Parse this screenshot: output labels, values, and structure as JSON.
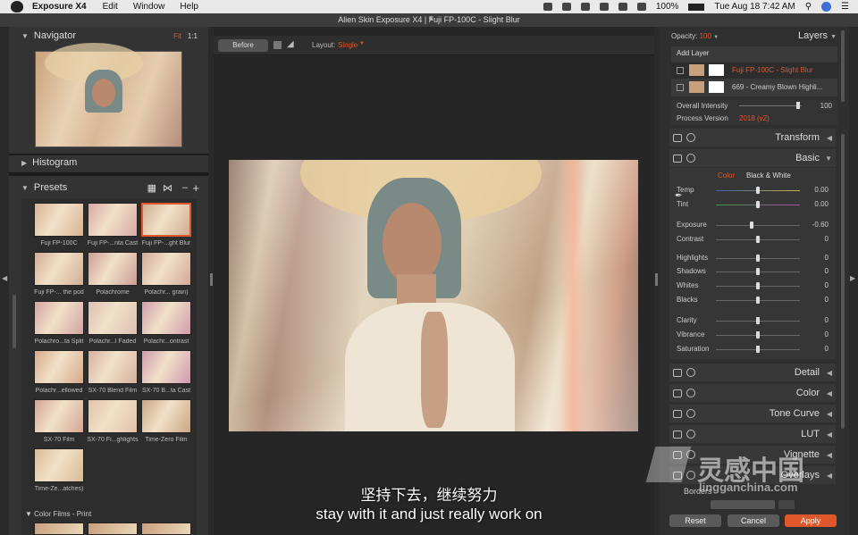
{
  "menubar": {
    "app": "Exposure X4",
    "items": [
      "Edit",
      "Window",
      "Help"
    ],
    "battery": "100%",
    "datetime": "Tue Aug 18  7:42 AM"
  },
  "window": {
    "title": "Alien Skin Exposure X4 | Fuji FP-100C - Slight Blur"
  },
  "navigator": {
    "title": "Navigator",
    "zoom_fit": "Fit",
    "zoom_1": "1:1"
  },
  "histogram": {
    "title": "Histogram"
  },
  "presets": {
    "title": "Presets",
    "items": [
      {
        "label": "Fuji FP-100C"
      },
      {
        "label": "Fuji FP-...nta Cast"
      },
      {
        "label": "Fuji FP-...ght Blur"
      },
      {
        "label": "Fuji FP-... the pod"
      },
      {
        "label": "Polachrome"
      },
      {
        "label": "Polachr... grain)"
      },
      {
        "label": "Polachro...ta Split"
      },
      {
        "label": "Polachr...l Faded"
      },
      {
        "label": "Polachr...ontrast"
      },
      {
        "label": "Polachr...ellowed"
      },
      {
        "label": "SX-70 Blend Film"
      },
      {
        "label": "SX-70 B...ta Cast"
      },
      {
        "label": "SX-70 Film"
      },
      {
        "label": "SX-70 Fi...ghlights"
      },
      {
        "label": "Time-Zero Film"
      },
      {
        "label": "Time-Ze...atches)"
      }
    ],
    "group": "Color Films - Print"
  },
  "toolbar": {
    "before_label": "Before",
    "layout_label": "Layout:",
    "layout_value": "Single"
  },
  "layers": {
    "opacity_label": "Opacity:",
    "opacity_value": "100",
    "title": "Layers",
    "add_layer": "Add Layer",
    "items": [
      {
        "name": "Fuji FP-100C - Slight Blur"
      },
      {
        "name": "669 - Creamy Blown Highli..."
      }
    ],
    "overall_intensity_label": "Overall Intensity",
    "overall_intensity_value": "100",
    "process_version_label": "Process Version",
    "process_version_value": "2018 (v2)"
  },
  "panels": {
    "transform": "Transform",
    "basic": "Basic",
    "color_tab": "Color",
    "bw_tab": "Black & White",
    "detail": "Detail",
    "color": "Color",
    "tone_curve": "Tone Curve",
    "lut": "LUT",
    "vignette": "Vignette",
    "overlays": "Overlays",
    "borders": "Borders"
  },
  "basic_sliders": [
    {
      "label": "Temp",
      "value": "0.00",
      "level": 0.5
    },
    {
      "label": "Tint",
      "value": "0.00",
      "level": 0.5
    },
    {
      "label": "Exposure",
      "value": "-0.60",
      "level": 0.43
    },
    {
      "label": "Contrast",
      "value": "0",
      "level": 0.5
    },
    {
      "label": "Highlights",
      "value": "0",
      "level": 0.5
    },
    {
      "label": "Shadows",
      "value": "0",
      "level": 0.5
    },
    {
      "label": "Whites",
      "value": "0",
      "level": 0.5
    },
    {
      "label": "Blacks",
      "value": "0",
      "level": 0.5
    },
    {
      "label": "Clarity",
      "value": "0",
      "level": 0.5
    },
    {
      "label": "Vibrance",
      "value": "0",
      "level": 0.5
    },
    {
      "label": "Saturation",
      "value": "0",
      "level": 0.5
    }
  ],
  "buttons": {
    "reset": "Reset",
    "cancel": "Cancel",
    "apply": "Apply"
  },
  "subtitles": {
    "zh": "坚持下去，继续努力",
    "en": "stay with it and just really work on"
  },
  "watermark": {
    "cn": "灵感中国",
    "url": "lingganchina.com"
  },
  "colors": {
    "accent": "#e0572b",
    "apply": "#e0572b"
  }
}
